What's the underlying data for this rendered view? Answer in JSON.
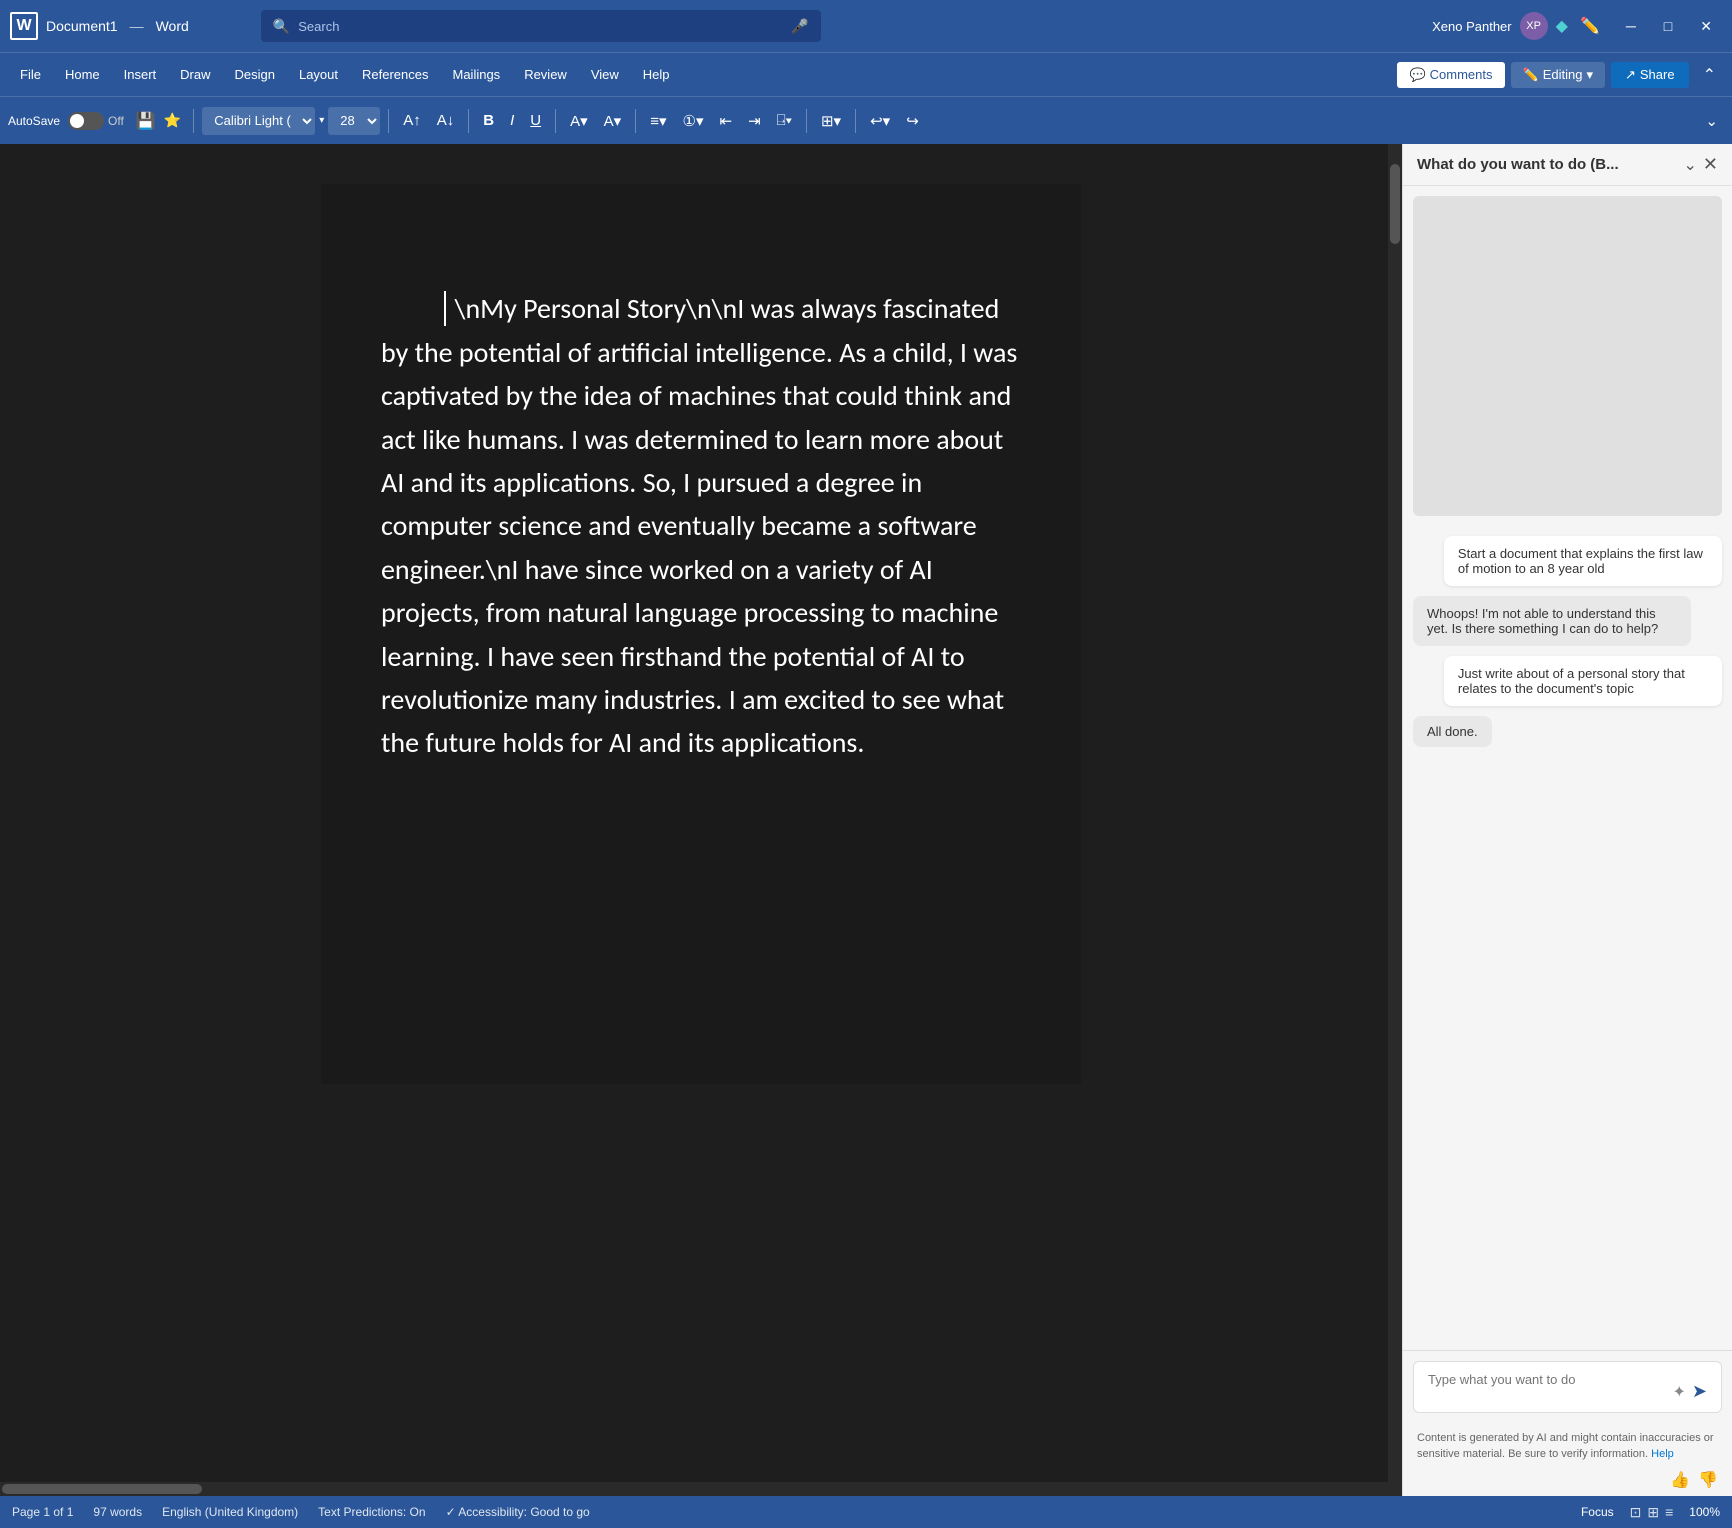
{
  "titlebar": {
    "app_name": "Word",
    "doc_name": "Document1",
    "separator": "—",
    "search_placeholder": "Search",
    "username": "Xeno Panther",
    "window_buttons": {
      "minimize": "─",
      "maximize": "□",
      "close": "✕"
    }
  },
  "menubar": {
    "items": [
      "File",
      "Home",
      "Insert",
      "Draw",
      "Design",
      "Layout",
      "References",
      "Mailings",
      "Review",
      "View",
      "Help"
    ],
    "comments_label": "Comments",
    "editing_label": "Editing",
    "share_label": "Share"
  },
  "toolbar": {
    "autosave_label": "AutoSave",
    "toggle_state": "Off",
    "font_name": "Calibri Light (",
    "font_size": "28",
    "bold": "B",
    "italic": "I",
    "underline": "U"
  },
  "document": {
    "content": "\\nMy Personal Story\\n\\nI was always fascinated by the potential of artificial intelligence. As a child, I was captivated by the idea of machines that could think and act like humans. I was determined to learn more about AI and its applications. So, I pursued a degree in computer science and eventually became a software engineer.\\nI have since worked on a variety of AI projects, from natural language processing to machine learning. I have seen firsthand the potential of AI to revolutionize many industries. I am excited to see what the future holds for AI and its applications."
  },
  "side_panel": {
    "title": "What do you want to do (B...",
    "messages": [
      {
        "type": "user",
        "text": "Start a document that explains the first law of motion to an 8 year old"
      },
      {
        "type": "ai",
        "text": "Whoops! I'm not able to understand this yet. Is there something I can do to help?"
      },
      {
        "type": "user",
        "text": "Just write about of a personal story that relates to the document's topic"
      },
      {
        "type": "ai_done",
        "text": "All done."
      }
    ],
    "input_placeholder": "Type what you want to do",
    "disclaimer": "Content is generated by AI and might contain inaccuracies or sensitive material. Be sure to verify information.",
    "help_label": "Help"
  },
  "statusbar": {
    "page_info": "Page 1 of 1",
    "word_count": "97 words",
    "language": "English (United Kingdom)",
    "text_predictions": "Text Predictions: On",
    "accessibility": "Accessibility: Good to go",
    "focus_label": "Focus",
    "zoom_level": "100%"
  }
}
